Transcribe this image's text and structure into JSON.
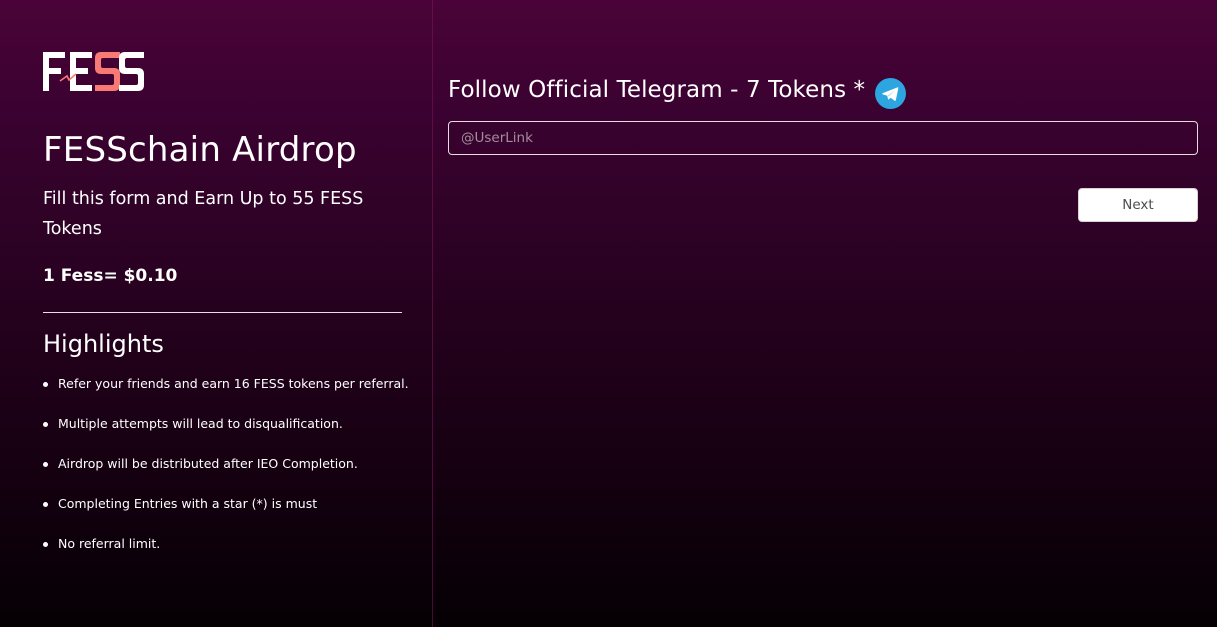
{
  "brand": {
    "logo_text": "FESS",
    "logo_colors": {
      "primary": "#ffffff",
      "accent": "#ff6b6b"
    }
  },
  "left": {
    "title": "FESSchain Airdrop",
    "subtitle": "Fill this form and Earn Up to 55 FESS Tokens",
    "price": "1 Fess= $0.10",
    "highlights_title": "Highlights",
    "highlights": [
      "Refer your friends and earn 16 FESS tokens per referral.",
      "Multiple attempts will lead to disqualification.",
      "Airdrop will be distributed after IEO Completion.",
      "Completing Entries with a star (*) is must",
      "No referral limit."
    ]
  },
  "form": {
    "field_label": "Follow Official Telegram - 7 Tokens *",
    "field_icon": "telegram-icon",
    "input_placeholder": "@UserLink",
    "input_value": "",
    "next_label": "Next"
  },
  "colors": {
    "background_top": "#4a0338",
    "background_bottom": "#050004",
    "telegram_blue": "#2ca5e0",
    "button_bg": "#ffffff"
  }
}
